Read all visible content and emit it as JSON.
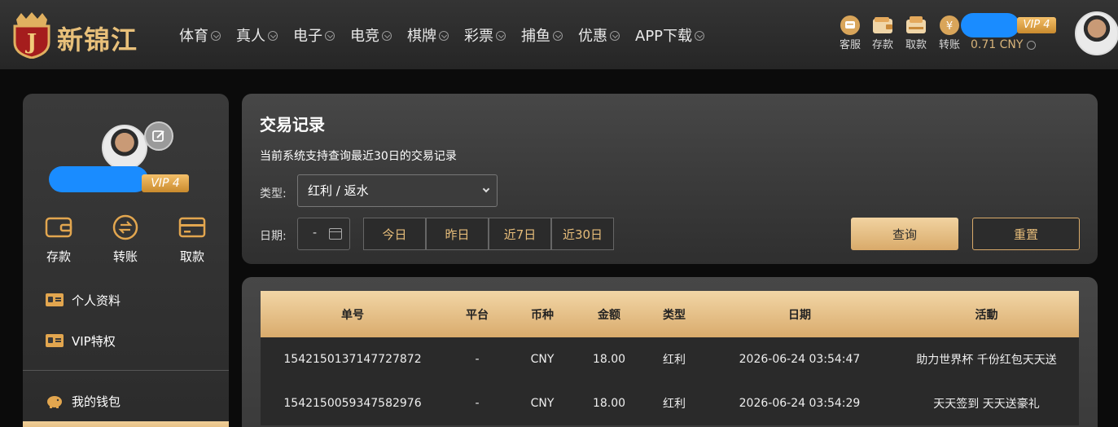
{
  "header": {
    "logo_text": "新锦江",
    "nav": [
      "体育",
      "真人",
      "电子",
      "电竞",
      "棋牌",
      "彩票",
      "捕鱼",
      "优惠",
      "APP下载"
    ],
    "tools": [
      {
        "label": "客服",
        "icon": "chat-icon"
      },
      {
        "label": "存款",
        "icon": "wallet-icon"
      },
      {
        "label": "取款",
        "icon": "withdraw-icon"
      },
      {
        "label": "转账",
        "icon": "transfer-icon"
      }
    ],
    "vip": "VIP 4",
    "balance": "0.71 CNY"
  },
  "sidebar": {
    "vip": "VIP 4",
    "actions": [
      {
        "label": "存款",
        "icon": "wallet-icon"
      },
      {
        "label": "转账",
        "icon": "transfer-icon"
      },
      {
        "label": "取款",
        "icon": "card-icon"
      }
    ],
    "menu": [
      {
        "label": "个人资料",
        "icon": "id-card-icon"
      },
      {
        "label": "VIP特权",
        "icon": "id-card-icon"
      },
      {
        "label": "我的钱包",
        "icon": "piggy-bank-icon"
      }
    ]
  },
  "filter": {
    "title": "交易记录",
    "subtitle": "当前系统支持查询最近30日的交易记录",
    "type_label": "类型:",
    "type_value": "红利 / 返水",
    "date_label": "日期:",
    "date_value": "-",
    "quick": [
      "今日",
      "昨日",
      "近7日",
      "近30日"
    ],
    "query": "查询",
    "reset": "重置"
  },
  "table": {
    "headers": [
      "单号",
      "平台",
      "币种",
      "金额",
      "类型",
      "日期",
      "活動"
    ],
    "rows": [
      [
        "1542150137147727872",
        "-",
        "CNY",
        "18.00",
        "红利",
        "2026-06-24 03:54:47",
        "助力世界杯 千份红包天天送"
      ],
      [
        "1542150059347582976",
        "-",
        "CNY",
        "18.00",
        "红利",
        "2026-06-24 03:54:29",
        "天天签到 天天送豪礼"
      ]
    ]
  },
  "colors": {
    "accent": "#d9ab6c",
    "gold_text": "#e7bd7a",
    "mask": "#1a8cff"
  }
}
